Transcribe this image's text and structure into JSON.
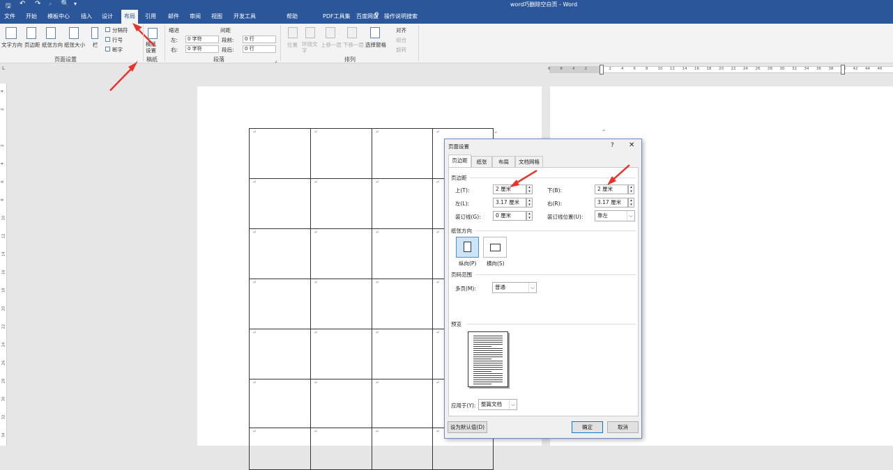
{
  "window": {
    "title": "word巧删除空白页 - Word"
  },
  "quick_access": {
    "save": "save-icon",
    "undo": "undo-icon",
    "redo": "redo-icon",
    "preview": "print-preview-icon",
    "customize": "▾"
  },
  "tabs": [
    "文件",
    "开始",
    "模板中心",
    "插入",
    "设计",
    "布局",
    "引用",
    "邮件",
    "审阅",
    "视图",
    "开发工具",
    "帮助",
    "PDF工具集",
    "百度网盘",
    "操作说明搜索"
  ],
  "active_tab": "布局",
  "ribbon": {
    "page_setup": {
      "label": "页面设置",
      "text_dir": "文字方向",
      "margins": "页边距",
      "orientation": "纸张方向",
      "size": "纸张大小",
      "columns": "栏",
      "breaks": "分隔符",
      "line_numbers": "行号",
      "hyphenation": "断字"
    },
    "manuscript": {
      "label": "稿纸",
      "btn": "稿纸设置"
    },
    "paragraph": {
      "label": "段落",
      "indent": "缩进",
      "spacing": "间距",
      "left_label": "左:",
      "left_val": "0 字符",
      "right_label": "右:",
      "right_val": "0 字符",
      "before_label": "段前:",
      "before_val": "0 行",
      "after_label": "段后:",
      "after_val": "0 行"
    },
    "arrange": {
      "label": "排列",
      "position": "位置",
      "wrap": "环绕文字",
      "forward": "上移一层",
      "backward": "下移一层",
      "pane": "选择窗格",
      "align": "对齐",
      "group": "组合",
      "rotate": "旋转"
    }
  },
  "ruler": {
    "numbers": [
      "8",
      "6",
      "4",
      "2",
      "",
      "2",
      "4",
      "6",
      "8",
      "10",
      "12",
      "14",
      "16",
      "18",
      "20",
      "22",
      "24",
      "26",
      "28",
      "30",
      "32",
      "34",
      "36",
      "38",
      "40",
      "42",
      "44",
      "46"
    ],
    "tab_icon": "L"
  },
  "vruler": {
    "numbers": [
      "4",
      "2",
      "",
      "2",
      "4",
      "6",
      "8",
      "10",
      "12",
      "14",
      "16",
      "18",
      "20",
      "22",
      "24",
      "26",
      "28",
      "30",
      "32",
      "34"
    ]
  },
  "document": {
    "para_mark": "↵"
  },
  "dialog": {
    "title": "页面设置",
    "help": "?",
    "close": "✕",
    "tabs": [
      "页边距",
      "纸张",
      "布局",
      "文档网格"
    ],
    "margins_section": "页边距",
    "top_label": "上(T):",
    "top_val": "2 厘米",
    "bottom_label": "下(B):",
    "bottom_val": "2 厘米",
    "left_label": "左(L):",
    "left_val": "3.17 厘米",
    "right_label": "右(R):",
    "right_val": "3.17 厘米",
    "gutter_label": "装订线(G):",
    "gutter_val": "0 厘米",
    "gutter_pos_label": "装订线位置(U):",
    "gutter_pos_val": "靠左",
    "orientation_section": "纸张方向",
    "portrait": "纵向(P)",
    "landscape": "横向(S)",
    "pages_section": "页码范围",
    "multi_label": "多页(M):",
    "multi_val": "普通",
    "preview_section": "预览",
    "apply_label": "应用于(Y):",
    "apply_val": "整篇文档",
    "default_btn": "设为默认值(D)",
    "ok_btn": "确定",
    "cancel_btn": "取消"
  },
  "colors": {
    "brand": "#2b579a",
    "arrow": "#e8332c"
  }
}
